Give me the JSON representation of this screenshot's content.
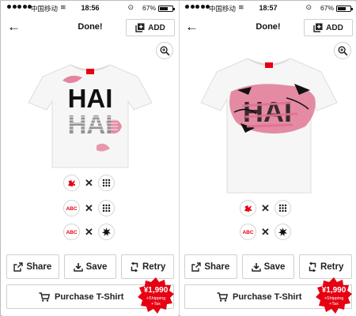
{
  "status_bar": {
    "carrier": "中国移动",
    "battery_percent": "67%",
    "battery_level": 0.67
  },
  "screens": [
    {
      "time": "18:56",
      "nav": {
        "title": "Done!",
        "add_label": "ADD"
      },
      "design": {
        "text_line_1": "HAI",
        "text_line_2": "HAI"
      },
      "combos": [
        {
          "left_icon": "splash-logo-icon",
          "right_icon": "dot-grid-icon"
        },
        {
          "left_icon": "abc-letters-icon",
          "right_icon": "dot-grid-icon"
        },
        {
          "left_icon": "abc-letters-icon",
          "right_icon": "ink-splat-icon"
        }
      ],
      "actions": {
        "share": "Share",
        "save": "Save",
        "retry": "Retry"
      },
      "purchase_label": "Purchase T-Shirt",
      "price": "¥1,990",
      "price_note": "+Shipping\n+Tax"
    },
    {
      "time": "18:57",
      "nav": {
        "title": "Done!",
        "add_label": "ADD"
      },
      "design": {
        "text_line_1": "HAI"
      },
      "combos": [
        {
          "left_icon": "splash-logo-icon",
          "right_icon": "dot-grid-icon"
        },
        {
          "left_icon": "abc-letters-icon",
          "right_icon": "ink-splat-icon"
        }
      ],
      "actions": {
        "share": "Share",
        "save": "Save",
        "retry": "Retry"
      },
      "purchase_label": "Purchase T-Shirt",
      "price": "¥1,990",
      "price_note": "+Shipping\n+Tax"
    }
  ],
  "icon_letters": "ABC",
  "colors": {
    "brand_red": "#e60012",
    "pink": "#e0718f",
    "text": "#222222",
    "border": "#cfcfcf"
  }
}
